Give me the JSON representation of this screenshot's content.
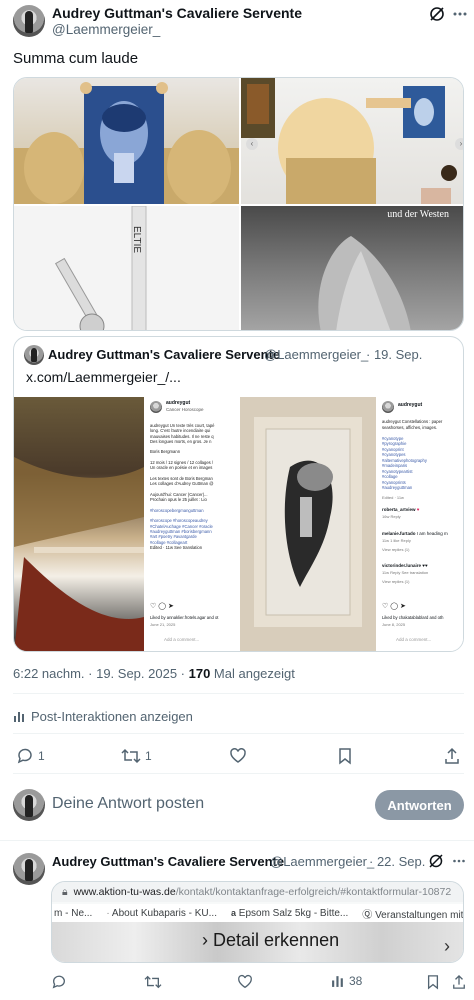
{
  "post": {
    "author_name": "Audrey Guttman's Cavaliere Servente",
    "author_handle": "@Laemmergeier_",
    "text": "Summa cum laude",
    "timestamp": "6:22 nachm. · 19. Sep. 2025 · ",
    "views_count": "170",
    "views_label": " Mal angezeigt",
    "interactions_label": "Post-Interaktionen anzeigen",
    "reply_count": "1",
    "repost_count": "1"
  },
  "quote": {
    "author_name": "Audrey Guttman's Cavaliere Servente",
    "author_handle": "@Laemmergeier_",
    "date": "· 19. Sep.",
    "text": "x.com/Laemmergeier_/...",
    "ig_left": {
      "username": "audreygut",
      "subtitle": "Cancer Horoscope",
      "caption_lines": [
        "audreygut Un texte très court, tapé",
        "long. C'est l'autre incendiaire qui",
        "mauvaises habitudes. Il ne reste q",
        "Des longues morts, en gros. Je n",
        "",
        "Boris Bergmann",
        "",
        "12 mois / 12 signes / 12 collages /",
        "Un oracle en poésie et en images",
        "",
        "Les textes sont de Boris Bergman",
        "Les collages d'Audrey Guttman @",
        "",
        "Aujourd'hui: Cancer (Cancer)...",
        "Prochain opus le 25 juillet : Lio",
        "",
        "#horoscopebergmanguttman",
        "",
        "#horoscope #horoscopeaudrey",
        "#ChatelAuchage #Cancer #oracle",
        "#audreyguttman #borisbergmann",
        "#art #poetry #avantgarde",
        "#collage #collageart",
        "Edited · 11w  See translation"
      ],
      "liked_by": "Liked by annaklier.frotels.agar and ot",
      "date": "June 21, 2025",
      "comment_placeholder": "Add a comment..."
    },
    "ig_right": {
      "username": "audreygut",
      "caption_lines": [
        "audreygut Constellations : paper",
        "seashorses, affiches, images.",
        "",
        "#cyanotype",
        "#pyrographie",
        "#cyanoprint",
        "#cyanotypes",
        "#alternativephotography",
        "#madeinparis",
        "#cyanotypeartist",
        "#collage",
        "#cyanoprints",
        "#audreyguttman"
      ],
      "edited": "Edited · 11w",
      "comments": [
        {
          "user": "roberta_artview",
          "text": "♥",
          "meta": "16w  Reply"
        },
        {
          "user": "melanie.furtado",
          "text": "I am heading m",
          "meta": "11w  1 like  Reply"
        },
        {
          "user": "victorinder.lunaire",
          "text": "♥♥",
          "meta": "11w  Reply  See translation"
        }
      ],
      "view_replies": "View replies (1)",
      "liked_by": "Liked by chakatablablard and oth",
      "date": "June 8, 2025",
      "comment_placeholder": "Add a comment..."
    }
  },
  "reply_box": {
    "placeholder": "Deine Antwort posten",
    "button_label": "Antworten"
  },
  "next_post": {
    "author_name": "Audrey Guttman's Cavaliere Servente",
    "author_handle": "@Laemmergeier_",
    "date": "· 22. Sep.",
    "browser": {
      "url_domain": "www.aktion-tu-was.de",
      "url_path": "/kontakt/kontaktanfrage-erfolgreich/#kontaktformular-10872",
      "bookmarks": [
        "m - Ne...",
        "About Kubaparis - KU...",
        "Epsom Salz 5kg - Bitte...",
        "Veranstaltungen mit f..."
      ],
      "overlay_text": "Detail erkennen"
    },
    "views_count": "38"
  },
  "images": {
    "top_right_caption": "und der Westen",
    "vase_text": "ELTIE"
  },
  "colors": {
    "accent": "#1d9bf0",
    "text": "#0f1419",
    "muted": "#536471",
    "border": "#cfd9de",
    "reply_button": "#8b98a5"
  }
}
